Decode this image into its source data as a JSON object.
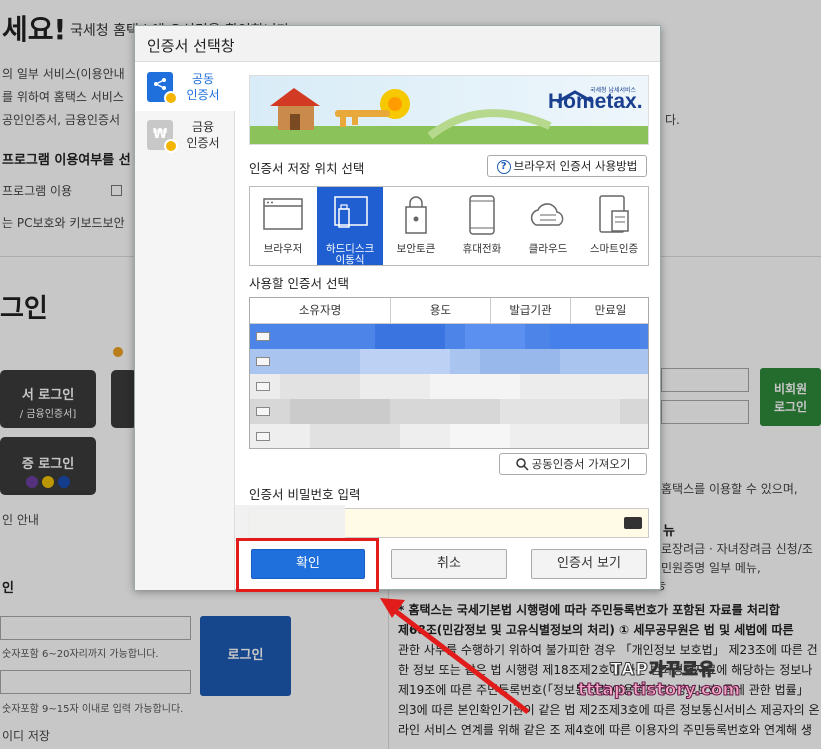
{
  "background": {
    "heading": "세요!",
    "subheading": "국세청 홈택스에 오신것을 환영합니다",
    "lines": [
      "의 일부 서비스(이용안내",
      "를 위하여 홈택스 서비스",
      "공인인증서, 금융인증서",
      "다."
    ],
    "program_question": "프로그램 이용여부를 선",
    "program_use_label": "프로그램 이용",
    "pc_note": "는 PC보호와 키보드보안",
    "login_title": "그인",
    "cert_login_btn": "서 로그인",
    "cert_login_sub": "/ 금융인증서]",
    "simple_login_btn": "증 로그인",
    "guide": "인 안내",
    "id_login": "인",
    "id_hint1": "숫자포함 6~20자리까지 가능합니다.",
    "id_hint2": "숫자포함 9~15자 이내로 입력 가능합니다.",
    "save_id": "이디 저장",
    "login_btn": "로그인",
    "nonmember_btn1": "비회원",
    "nonmember_btn2": "로그인",
    "right_text1": "홈택스를 이용할 수 있으며,",
    "right_text2": "뉴",
    "right_text3": "로장려금 · 자녀장려금 신청/조",
    "right_text4": "민원증명 일부 메뉴,",
    "right_text5": "능",
    "notice_lines": [
      "* 홈택스는 국세기본법 시행령에 따라 주민등록번호가 포함된 자료를 처리합",
      "제68조(민감정보 및 고유식별정보의 처리) ① 세무공무원은 법 및 세법에 따른",
      "관한 사무를 수행하기 위하여 불가피한 경우 「개인정보 보호법」 제23조에 따른 건",
      "한 정보 또는 같은 법 시행령 제18조제2호에 따른 범죄경력자료에 해당하는 정보나",
      "제19조에 따른 주민등록번호(「정보통신망 이용촉진 및 정보보호 등에 관한 법률」",
      "의3에 따른 본인확인기관이 같은 법 제2조제3호에 따른 정보통신서비스 제공자의 온",
      "라인 서비스 연계를 위해 같은 조 제4호에 따른 이용자의 주민등록번호와 연계해 생"
    ]
  },
  "dialog": {
    "title": "인증서 선택창",
    "sidebar": [
      {
        "label": "공동 인증서",
        "active": true
      },
      {
        "label": "금융 인증서",
        "active": false
      }
    ],
    "banner": {
      "logo_small": "국세청 납세서비스",
      "logo": "Hometax."
    },
    "location_title": "인증서 저장 위치 선택",
    "howto_label": "브라우저 인증서 사용방법",
    "locations": [
      {
        "label": "브라우저",
        "icon": "browser-icon"
      },
      {
        "label": "하드디스크 이동식",
        "icon": "usb-drive-icon",
        "active": true
      },
      {
        "label": "보안토큰",
        "icon": "security-token-icon"
      },
      {
        "label": "휴대전화",
        "icon": "mobile-phone-icon"
      },
      {
        "label": "클라우드",
        "icon": "cloud-icon"
      },
      {
        "label": "스마트인증",
        "icon": "smart-auth-icon"
      }
    ],
    "cert_select_title": "사용할 인증서 선택",
    "columns": [
      "소유자명",
      "용도",
      "발급기관",
      "만료일"
    ],
    "import_label": "공동인증서 가져오기",
    "password_title": "인증서 비밀번호 입력",
    "ok_label": "확인",
    "cancel_label": "취소",
    "view_label": "인증서 보기"
  },
  "watermark": {
    "line1": "TAP가꾸르유",
    "line2": "tttap.tistory.com"
  },
  "colors": {
    "primary_blue": "#1f6fdc",
    "highlight_red": "#e21b1b",
    "accent_yellow": "#f5b400"
  }
}
